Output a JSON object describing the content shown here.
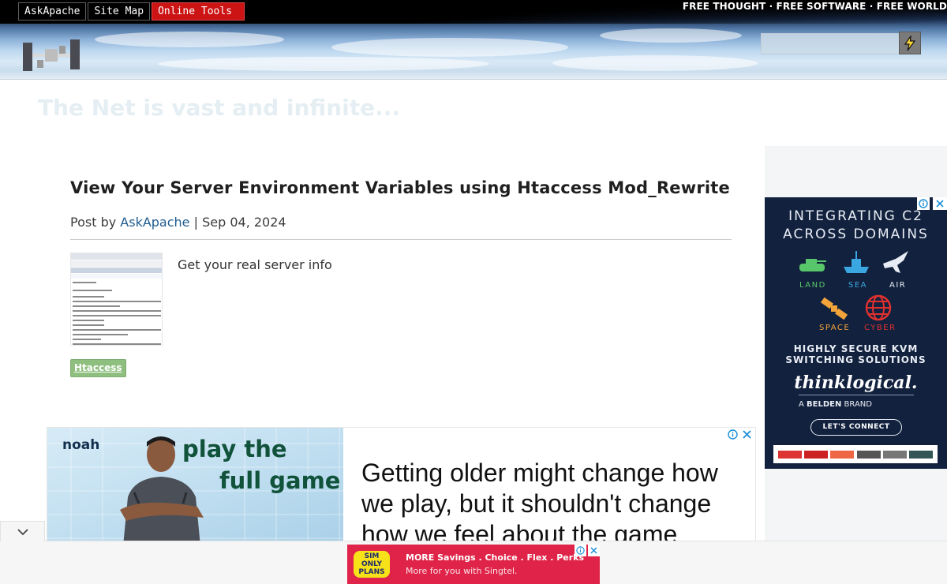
{
  "nav": {
    "items": [
      {
        "label": "AskApache"
      },
      {
        "label": "Site Map"
      },
      {
        "label": "Online Tools"
      }
    ]
  },
  "header": {
    "tagline": "FREE THOUGHT · FREE SOFTWARE · FREE WORLD",
    "search": {
      "value": "",
      "placeholder": ""
    },
    "search_button_icon": "lightning-icon"
  },
  "site": {
    "slogan": "The Net is vast and infinite..."
  },
  "post": {
    "title": "View Your Server Environment Variables using Htaccess Mod_Rewrite",
    "by_label": "Post by",
    "author": "AskApache",
    "separator": "|",
    "date": "Sep 04, 2024",
    "excerpt": "Get your real server info",
    "tag": "Htaccess"
  },
  "ad_mid": {
    "brand": "noah",
    "slogan_line1": "play the",
    "slogan_line2": "full game",
    "headline": "Getting older might change how we play, but it shouldn't change how we feel about the game"
  },
  "ad_right": {
    "headline_line1": "INTEGRATING C2",
    "headline_line2": "ACROSS DOMAINS",
    "domains": [
      {
        "label": "LAND",
        "color": "#58c66a"
      },
      {
        "label": "SEA",
        "color": "#3aa7e3"
      },
      {
        "label": "AIR",
        "color": "#e8edf5"
      },
      {
        "label": "SPACE",
        "color": "#f2a33a"
      },
      {
        "label": "CYBER",
        "color": "#e0312f"
      }
    ],
    "sub_line1": "HIGHLY SECURE KVM",
    "sub_line2": "SWITCHING SOLUTIONS",
    "brand": "thinklogical.",
    "belden_prefix": "A",
    "belden_name": "BELDEN",
    "belden_suffix": "BRAND",
    "cta": "LET'S CONNECT"
  },
  "ad_bottom": {
    "badge_line1": "SIM",
    "badge_line2": "ONLY",
    "badge_line3": "PLANS",
    "line1": "MORE Savings . Choice . Flex . Perks",
    "line2": "More for you with Singtel."
  },
  "colors": {
    "accent_red": "#cc1414",
    "link_blue": "#1f5c8f",
    "tag_green": "#8fbf7f",
    "ad_navy": "#12213d",
    "singtel_red": "#e02449"
  }
}
